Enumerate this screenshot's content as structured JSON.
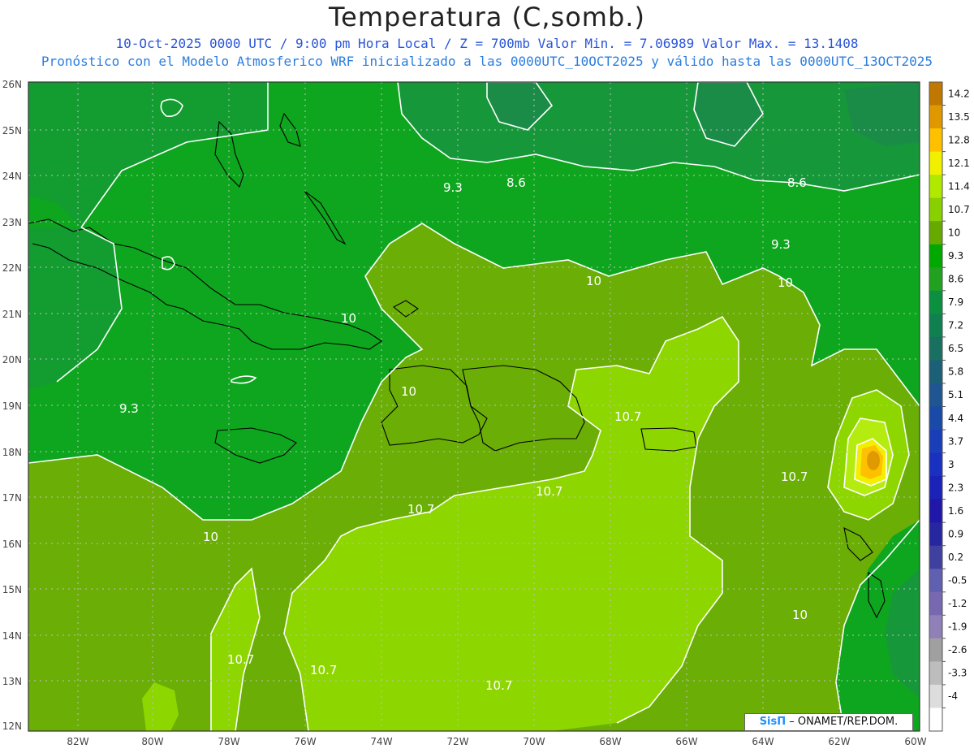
{
  "header": {
    "title": "Temperatura (C,somb.)",
    "line1": "10-Oct-2025  0000 UTC / 9:00 pm Hora Local / Z = 700mb    Valor Min. = 7.06989  Valor Max. = 13.1408",
    "line2": "Pronóstico con el Modelo Atmosferico WRF inicializado a las 0000UTC_10OCT2025 y válido hasta las  0000UTC_13OCT2025"
  },
  "axes": {
    "lat_labels": [
      "26N",
      "25N",
      "24N",
      "23N",
      "22N",
      "21N",
      "20N",
      "19N",
      "18N",
      "17N",
      "16N",
      "15N",
      "14N",
      "13N",
      "12N"
    ],
    "lon_labels": [
      "82W",
      "80W",
      "78W",
      "76W",
      "74W",
      "72W",
      "70W",
      "68W",
      "66W",
      "64W",
      "62W",
      "60W"
    ]
  },
  "legend": {
    "levels": [
      "14.2",
      "13.5",
      "12.8",
      "12.1",
      "11.4",
      "10.7",
      "10",
      "9.3",
      "8.6",
      "7.9",
      "7.2",
      "6.5",
      "5.8",
      "5.1",
      "4.4",
      "3.7",
      "3",
      "2.3",
      "1.6",
      "0.9",
      "0.2",
      "-0.5",
      "-1.2",
      "-1.9",
      "-2.6",
      "-3.3",
      "-4"
    ],
    "colors": [
      "#c07800",
      "#e09800",
      "#ffc000",
      "#f0f000",
      "#b0e800",
      "#88d000",
      "#66aa00",
      "#00a800",
      "#22a020",
      "#0b9040",
      "#108050",
      "#1a7060",
      "#1c6078",
      "#1f5590",
      "#1a4aa8",
      "#1a3eb8",
      "#1a30c0",
      "#1a22b8",
      "#2016a8",
      "#2626a0",
      "#4040a0",
      "#6060b0",
      "#7868b0",
      "#9080b8",
      "#a0a0a0",
      "#bdbdbd",
      "#dddddd",
      "#ffffff"
    ]
  },
  "contour_labels": [
    "9.3",
    "8.6",
    "8.6",
    "9.3",
    "10",
    "10",
    "10",
    "9.3",
    "10",
    "10.7",
    "10.7",
    "10.7",
    "10.7",
    "10",
    "10.7",
    "10.7",
    "10.7",
    "10"
  ],
  "credit": {
    "brand": "SisΠ",
    "text": "– ONAMET/REP.DOM."
  },
  "icons": [
    "map-canvas"
  ]
}
